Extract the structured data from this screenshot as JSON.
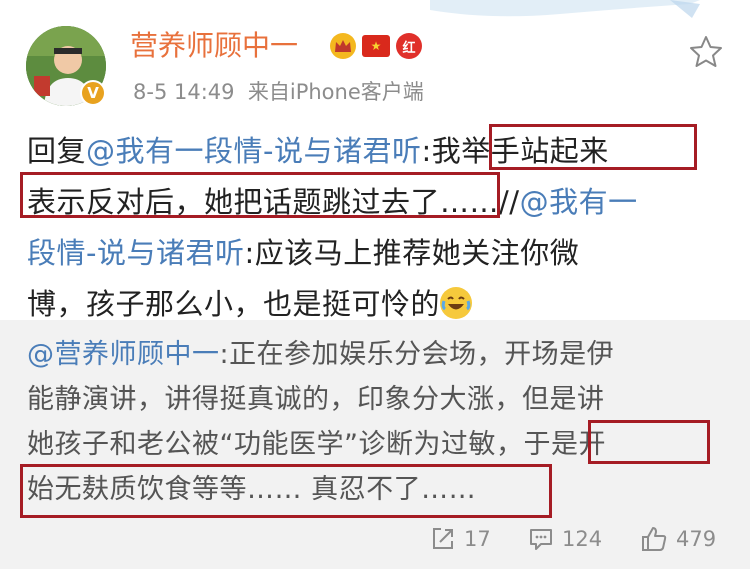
{
  "user": {
    "name": "营养师顾中一",
    "badge_red": "红",
    "verified": "V"
  },
  "meta": {
    "time": "8-5 14:49",
    "source": "来自iPhone客户端"
  },
  "post": {
    "reply_prefix": "回复",
    "mention1": "@我有一段情-说与诸君听",
    "colon1": ":",
    "text_line1_end": "我举手站起来",
    "text_line2": "表示反对后，她把话题跳过去了",
    "ellipsis": "……//",
    "mention2_part1": "@我有一",
    "mention2_part2": "段情-说与诸君听",
    "text_line3_end": ":应该马上推荐她关注你微",
    "text_line4": "博，孩子那么小，也是挺可怜的"
  },
  "quote": {
    "mention": "@营养师顾中一",
    "line1_rest": ":正在参加娱乐分会场，开场是伊",
    "line2": "能静演讲，讲得挺真诚的，印象分大涨，但是讲",
    "line3_start": "她孩子和老公被“功能医学”诊断为过敏，",
    "line3_end": "于是开",
    "line4": "始无麸质饮食等等…… 真忍不了……"
  },
  "footer": {
    "repost_count": "17",
    "comment_count": "124",
    "like_count": "479"
  },
  "colors": {
    "username": "#e8713c",
    "link": "#4a7db8",
    "highlight_box": "#a51c24",
    "quote_bg": "#f2f2f2"
  },
  "icons": [
    "star-icon",
    "repost-icon",
    "comment-icon",
    "like-icon",
    "crown-icon",
    "china-flag-icon",
    "verified-icon",
    "laughing-tears-emoji"
  ]
}
